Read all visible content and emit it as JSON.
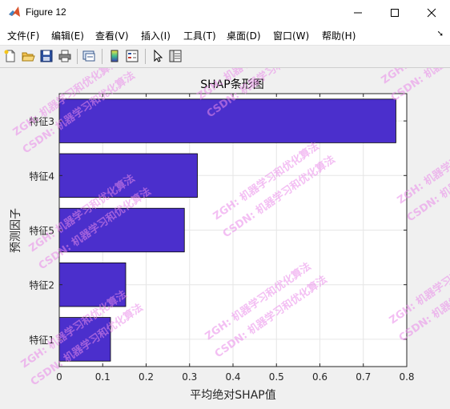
{
  "window": {
    "title": "Figure 12"
  },
  "menu": [
    "文件(F)",
    "编辑(E)",
    "查看(V)",
    "插入(I)",
    "工具(T)",
    "桌面(D)",
    "窗口(W)",
    "帮助(H)"
  ],
  "toolbar_icons": [
    "new-figure-icon",
    "open-file-icon",
    "save-icon",
    "print-icon",
    "link-plot-icon",
    "colorbar-icon",
    "legend-icon",
    "pointer-icon",
    "property-inspector-icon"
  ],
  "watermark": [
    "ZGH: 机器学习和优化算法",
    "CSDN: 机器学习和优化算法"
  ],
  "colors": {
    "bar_fill": "#4b2fcc",
    "bar_edge": "#000000",
    "grid": "#e6e6e6"
  },
  "chart_data": {
    "type": "bar",
    "orientation": "horizontal",
    "title": "SHAP条形图",
    "xlabel": "平均绝对SHAP值",
    "ylabel": "预测因子",
    "categories": [
      "特征3",
      "特征4",
      "特征5",
      "特征2",
      "特征1"
    ],
    "values": [
      0.775,
      0.318,
      0.288,
      0.153,
      0.118
    ],
    "xlim": [
      0,
      0.8
    ],
    "xticks": [
      "0",
      "0.1",
      "0.2",
      "0.3",
      "0.4",
      "0.5",
      "0.6",
      "0.7",
      "0.8"
    ],
    "grid": true
  }
}
